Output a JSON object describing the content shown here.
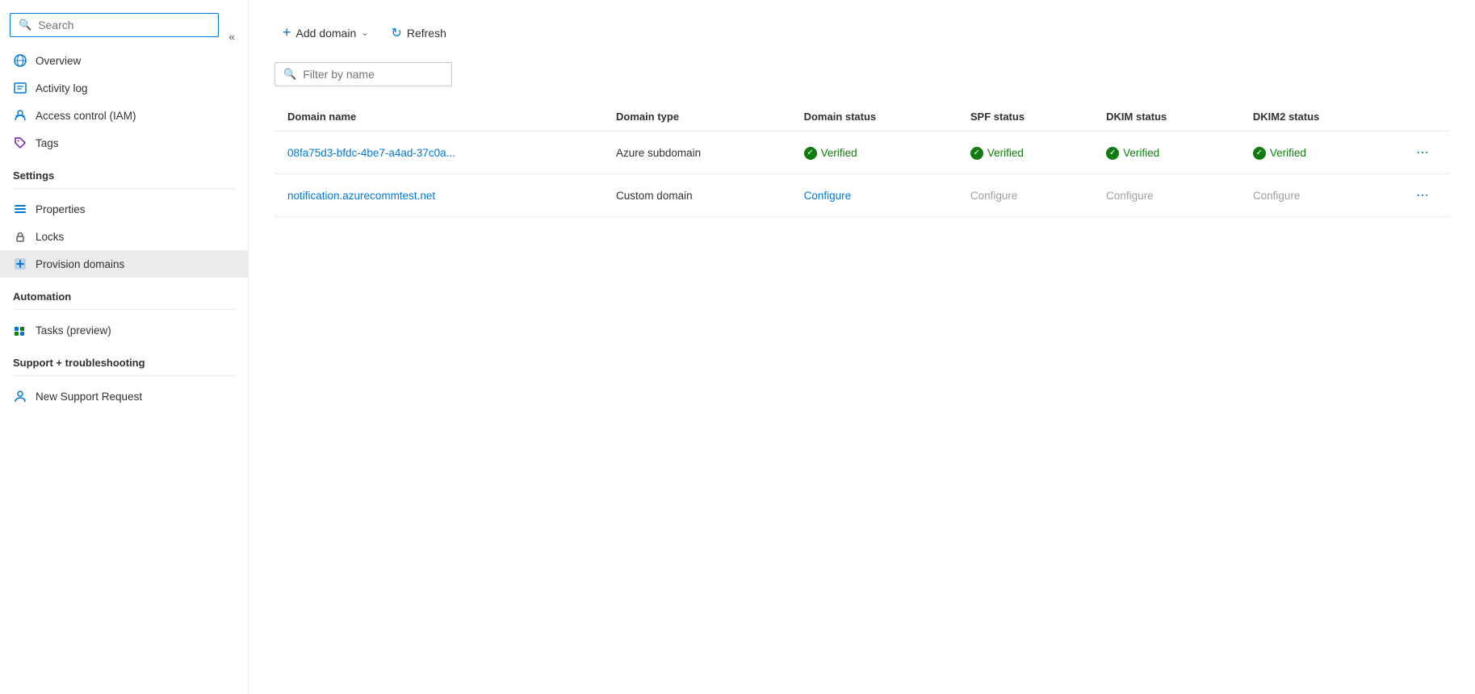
{
  "sidebar": {
    "search_placeholder": "Search",
    "collapse_icon": "«",
    "items_top": [
      {
        "id": "overview",
        "label": "Overview",
        "icon": "globe-icon"
      }
    ],
    "items_general": [
      {
        "id": "activity-log",
        "label": "Activity log",
        "icon": "activity-icon"
      },
      {
        "id": "access-control",
        "label": "Access control (IAM)",
        "icon": "iam-icon"
      },
      {
        "id": "tags",
        "label": "Tags",
        "icon": "tags-icon"
      }
    ],
    "section_settings": "Settings",
    "items_settings": [
      {
        "id": "properties",
        "label": "Properties",
        "icon": "properties-icon"
      },
      {
        "id": "locks",
        "label": "Locks",
        "icon": "lock-icon"
      },
      {
        "id": "provision-domains",
        "label": "Provision domains",
        "icon": "provision-icon",
        "active": true
      }
    ],
    "section_automation": "Automation",
    "items_automation": [
      {
        "id": "tasks",
        "label": "Tasks (preview)",
        "icon": "tasks-icon"
      }
    ],
    "section_support": "Support + troubleshooting",
    "items_support": [
      {
        "id": "new-support",
        "label": "New Support Request",
        "icon": "support-icon"
      }
    ]
  },
  "toolbar": {
    "add_domain_label": "Add domain",
    "add_domain_chevron": "∨",
    "refresh_label": "Refresh"
  },
  "filter": {
    "placeholder": "Filter by name"
  },
  "table": {
    "columns": [
      "Domain name",
      "Domain type",
      "Domain status",
      "SPF status",
      "DKIM status",
      "DKIM2 status"
    ],
    "rows": [
      {
        "domain_name": "08fa75d3-bfdc-4be7-a4ad-37c0a...",
        "domain_type": "Azure subdomain",
        "domain_status": "Verified",
        "domain_status_type": "verified",
        "spf_status": "Verified",
        "spf_status_type": "verified",
        "dkim_status": "Verified",
        "dkim_status_type": "verified",
        "dkim2_status": "Verified",
        "dkim2_status_type": "verified"
      },
      {
        "domain_name": "notification.azurecommtest.net",
        "domain_type": "Custom domain",
        "domain_status": "Configure",
        "domain_status_type": "link",
        "spf_status": "Configure",
        "spf_status_type": "muted",
        "dkim_status": "Configure",
        "dkim_status_type": "muted",
        "dkim2_status": "Configure",
        "dkim2_status_type": "muted"
      }
    ]
  }
}
